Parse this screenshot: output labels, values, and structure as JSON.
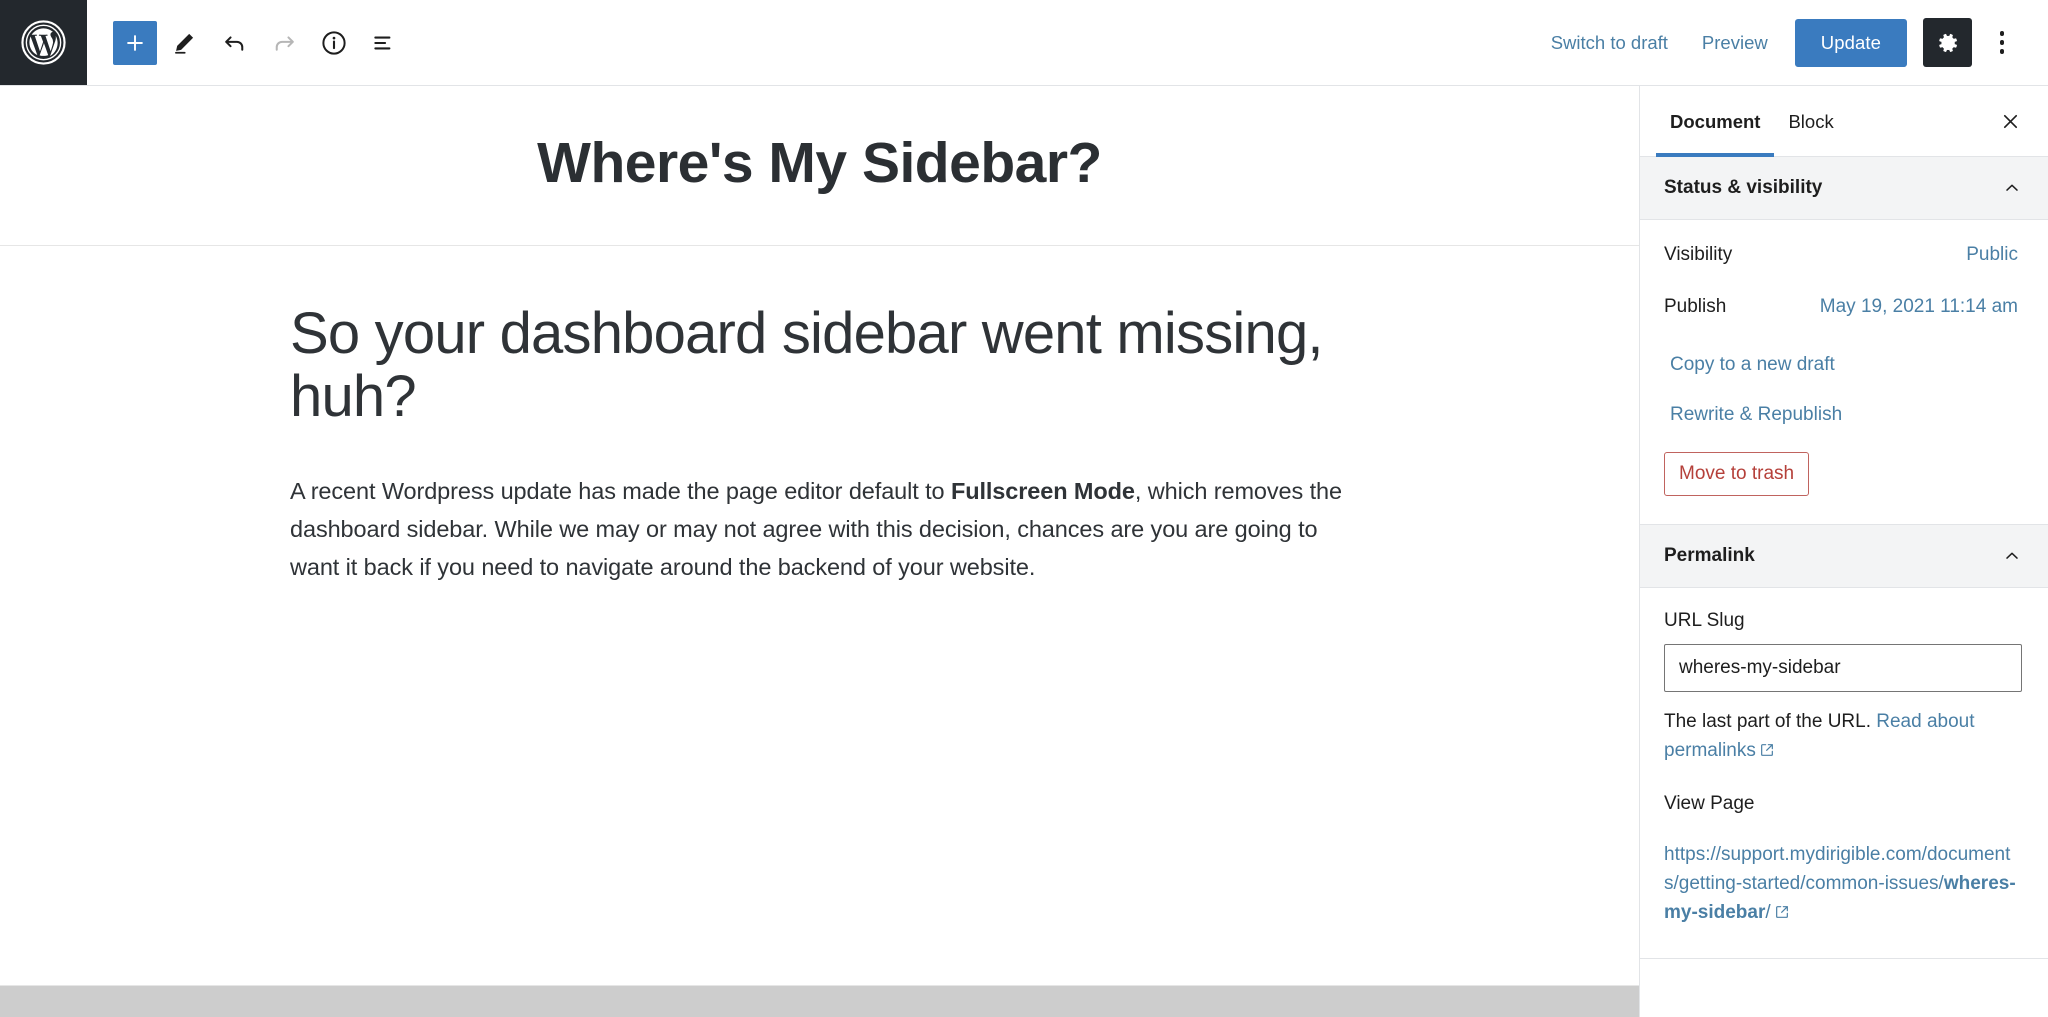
{
  "topbar": {
    "logo_icon": "wordpress-logo-icon",
    "tools": [
      {
        "name": "add-block-button",
        "icon": "plus-icon",
        "label": "Add block",
        "state": "primary"
      },
      {
        "name": "tools-edit-button",
        "icon": "pencil-icon",
        "label": "Tools",
        "state": "normal"
      },
      {
        "name": "undo-button",
        "icon": "undo-icon",
        "label": "Undo",
        "state": "normal"
      },
      {
        "name": "redo-button",
        "icon": "redo-icon",
        "label": "Redo",
        "state": "disabled"
      },
      {
        "name": "details-button",
        "icon": "info-icon",
        "label": "Details",
        "state": "normal"
      },
      {
        "name": "list-view-button",
        "icon": "list-view-icon",
        "label": "List view",
        "state": "normal"
      }
    ],
    "switch_to_draft": "Switch to draft",
    "preview": "Preview",
    "update": "Update",
    "settings_icon": "gear-icon",
    "more_icon": "kebab-menu-icon"
  },
  "editor": {
    "post_title": "Where's My Sidebar?",
    "heading": "So your dashboard sidebar went missing, huh?",
    "paragraph_part1": "A recent Wordpress update has made the page editor default to ",
    "paragraph_bold": "Fullscreen Mode",
    "paragraph_part2": ", which removes the dashboard sidebar. While we may or may not agree with this decision, chances are you are going to want it back if you need to navigate around the backend of your website."
  },
  "sidebar": {
    "tabs": [
      {
        "label": "Document",
        "active": true
      },
      {
        "label": "Block",
        "active": false
      }
    ],
    "close_icon": "close-icon",
    "status_panel": {
      "title": "Status & visibility",
      "chevron_icon": "chevron-up-icon",
      "rows": [
        {
          "label": "Visibility",
          "value": "Public"
        },
        {
          "label": "Publish",
          "value": "May 19, 2021 11:14 am"
        }
      ],
      "copy_draft": "Copy to a new draft",
      "rewrite_republish": "Rewrite & Republish",
      "move_to_trash": "Move to trash"
    },
    "permalink_panel": {
      "title": "Permalink",
      "chevron_icon": "chevron-up-icon",
      "slug_label": "URL Slug",
      "slug_value": "wheres-my-sidebar",
      "slug_placeholder": "wheres-my-sidebar",
      "help_prefix": "The last part of the URL. ",
      "help_link": "Read about permalinks",
      "view_page_label": "View Page",
      "url_prefix": "https://support.mydirigible.com/documents/getting-started/common-issues/",
      "url_slug_bold": "wheres-my-sidebar",
      "url_suffix": "/",
      "external_icon": "external-link-icon"
    }
  },
  "colors": {
    "accent_blue": "#3a7bbf",
    "link_blue": "#4a7fa5",
    "danger_red": "#b5403a",
    "dark_chrome": "#23282d",
    "panel_gray": "#f3f4f5",
    "scrollbar_gray": "#cdcdcd"
  }
}
